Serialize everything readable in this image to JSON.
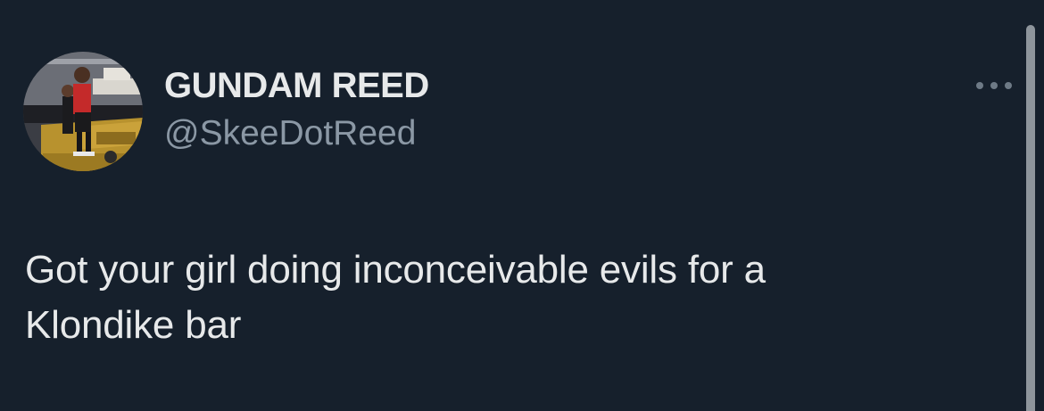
{
  "tweet": {
    "author": {
      "display_name": "GUNDAM REED",
      "handle": "@SkeeDotReed",
      "avatar_icon": "profile-photo"
    },
    "more_icon": "more-horizontal-icon",
    "text_lines": [
      "Got your girl doing inconceivable evils for a",
      "Klondike bar"
    ]
  },
  "colors": {
    "background": "#16202c",
    "primary_text": "#e7e9ea",
    "secondary_text": "#8b98a5"
  }
}
